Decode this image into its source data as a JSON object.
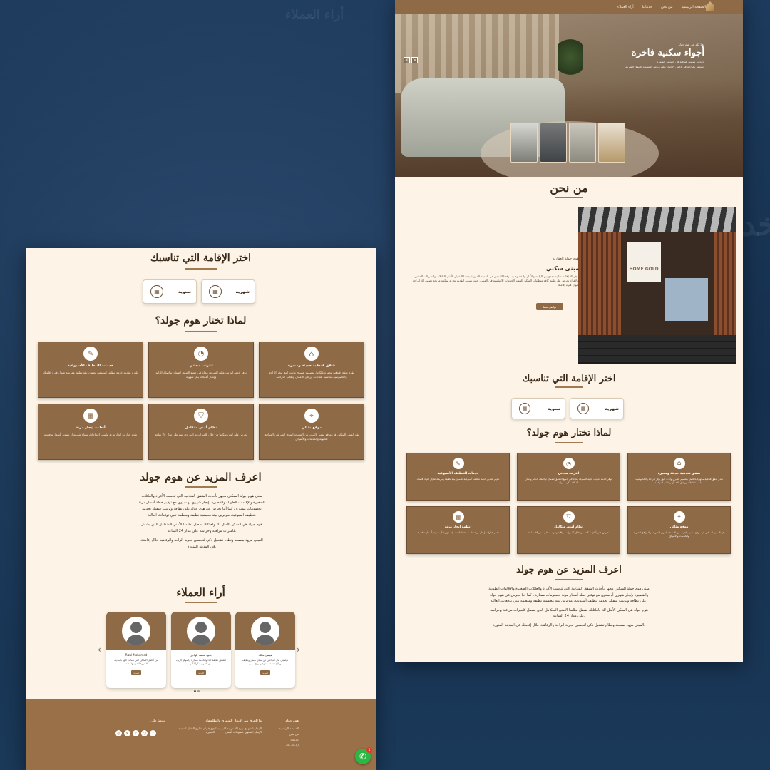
{
  "background_text": {
    "top": "أراء العملاء",
    "side": "لخد"
  },
  "nav": {
    "items": [
      "الصفحة الرئيسية",
      "من نحن",
      "خدماتنا",
      "أراء العملاء"
    ]
  },
  "hero": {
    "kicker": "أهلا بكم في هوم جولد",
    "title": "أجواء سكنية فاخرة",
    "line1": "وحدات سكنية فندقية في المدينة المنورة",
    "line2": "استمتع بالراحة في اجمل الاجواء بالقرب من المسجد النبوي الشريف"
  },
  "about": {
    "title": "من نحن",
    "subtitle": "هوم جولد العقارية",
    "name": "مبنى سكني",
    "text": "يوفر لك إقامة مثالية تجمع بين الراحة والأمان والخصوصية موقعنا المتميز في المدينة المنورة يجعلنا الاختيار الأمثل للعائلات والشركات الصغيرة والأفراد نحرص على تلبية كافة متطلبات السكن المميز الخدمات الأساسية في المبنى، حيث نسعى لتقديم تجربة سكنية مريحة تضمن لك الراحة طوال فترة إقامتك",
    "button": "تواصل معنا",
    "sign": "HOME GOLD"
  },
  "stay": {
    "title": "اختر الإقامة التي تناسبك",
    "options": [
      "شهرية",
      "سنوية"
    ]
  },
  "why": {
    "title": "لماذا تختار هوم جولد؟",
    "features": [
      {
        "title": "شقق فندقية حديثة ومميزة",
        "desc": "نقدم شقق فندقية مجهزة بالكامل بتصميم عصري وأثاث أنيق يوفر الراحة والخصوصية، مناسبة للعائلات ورجال الأعمال وطلاب الدراسة"
      },
      {
        "title": "انترنت مجاني",
        "desc": "نوفر خدمة انترنت عالية السرعة مجانا في جميع الشقق لضمان تواصلك الدائم وإنجاز أعمالك بكل سهولة"
      },
      {
        "title": "خدمات التنظيف الأسبوعية",
        "desc": "نلتزم بتقديم خدمة تنظيف أسبوعية لضمان بيئة نظيفة ومريحة طوال فترة إقامتك"
      },
      {
        "title": "موقع مثالي",
        "desc": "يقع المبنى السكني في موقع متميز بالقرب من المسجد النبوي الشريف والمرافق الحيوية والخدمات والأسواق"
      },
      {
        "title": "نظام أمني متكامل",
        "desc": "نحرص على أمان سكاننا من خلال كاميرات مراقبة وحراسة على مدار 24 ساعة"
      },
      {
        "title": "أنظمة إيجار مرنة",
        "desc": "نقدم خيارات إيجار مرنة تناسب احتياجاتك سواء شهرية أو سنوية بأسعار تنافسية"
      }
    ]
  },
  "more": {
    "title": "اعرف المزيد عن هوم جولد",
    "p1": "مبنى هوم جولد السكني مجهز بأحدث الشقق الفندقية التي تناسب الأفراد والعائلات الصغيرة والإقامات الطويلة والقصيرة بإيجار شهري أو سنوي مع توفير خطة أسعار مرنة بخصومات ممتازة ، كما أننا نحرص في هوم جولد على نظافة وترتيب شقتك بخدمة تنظيف أسبوعية، موفرين بيئة معيشية نظيفة ومنظمة تلبي توقعاتك العالية.",
    "p2": "هوم جولد هي السكن الأمثل لك ولعائلتك بفضل نظامنا الأمني المتكامل الذي يشمل كاميرات مراقبة وحراسة على مدار 24 الساعة.",
    "p3": "المبنى مزود بمصعد ونظام تشغيل ذكي لتحسين تجربة الراحة والرفاهية خلال إقامتك في المدينة المنورة."
  },
  "reviews": {
    "title": "أراء العملاء",
    "items": [
      {
        "name": "فيصل مالك",
        "text": "توصيتي لكل الباحثين عن سكن ممتاز ونظيف ورائع خدمة ممتازة وموقع مميز",
        "button": "المزيد"
      },
      {
        "name": "نجود محمد الهاجر",
        "text": "الشقق نظيفة جدا والخدمة ممتازة والموقع قريب من الحرم شكرا لكم",
        "button": "المزيد"
      },
      {
        "name": "Rizal Mohamed",
        "text": "من أفضل الأماكن التي سكنت فيها بالمدينة المنورة أنصح بها بشدة",
        "button": "المزيد"
      }
    ]
  },
  "footer": {
    "col1": {
      "title": "هوم جولد",
      "items": [
        "الصفحة الرئيسية",
        "من نحن",
        "خدماتنا",
        "أراء العملاء"
      ]
    },
    "col2": {
      "title": "ما الفرق بين الإيجار الشهري والسنوي",
      "text": "الإيجار الشهري يتيح لك مرونة أكبر بينما يوفر الإيجار السنوي خصومات أفضل"
    },
    "col3": {
      "title": "العنوان",
      "text": "حي قربان شارع النخيل المدينة المنورة"
    },
    "col4": {
      "title": "تابعنا على"
    }
  },
  "whatsapp": {
    "badge": "1"
  },
  "colors": {
    "brand": "#8f6a47",
    "cream": "#fdf4e7",
    "page_bg": "#16304f"
  }
}
